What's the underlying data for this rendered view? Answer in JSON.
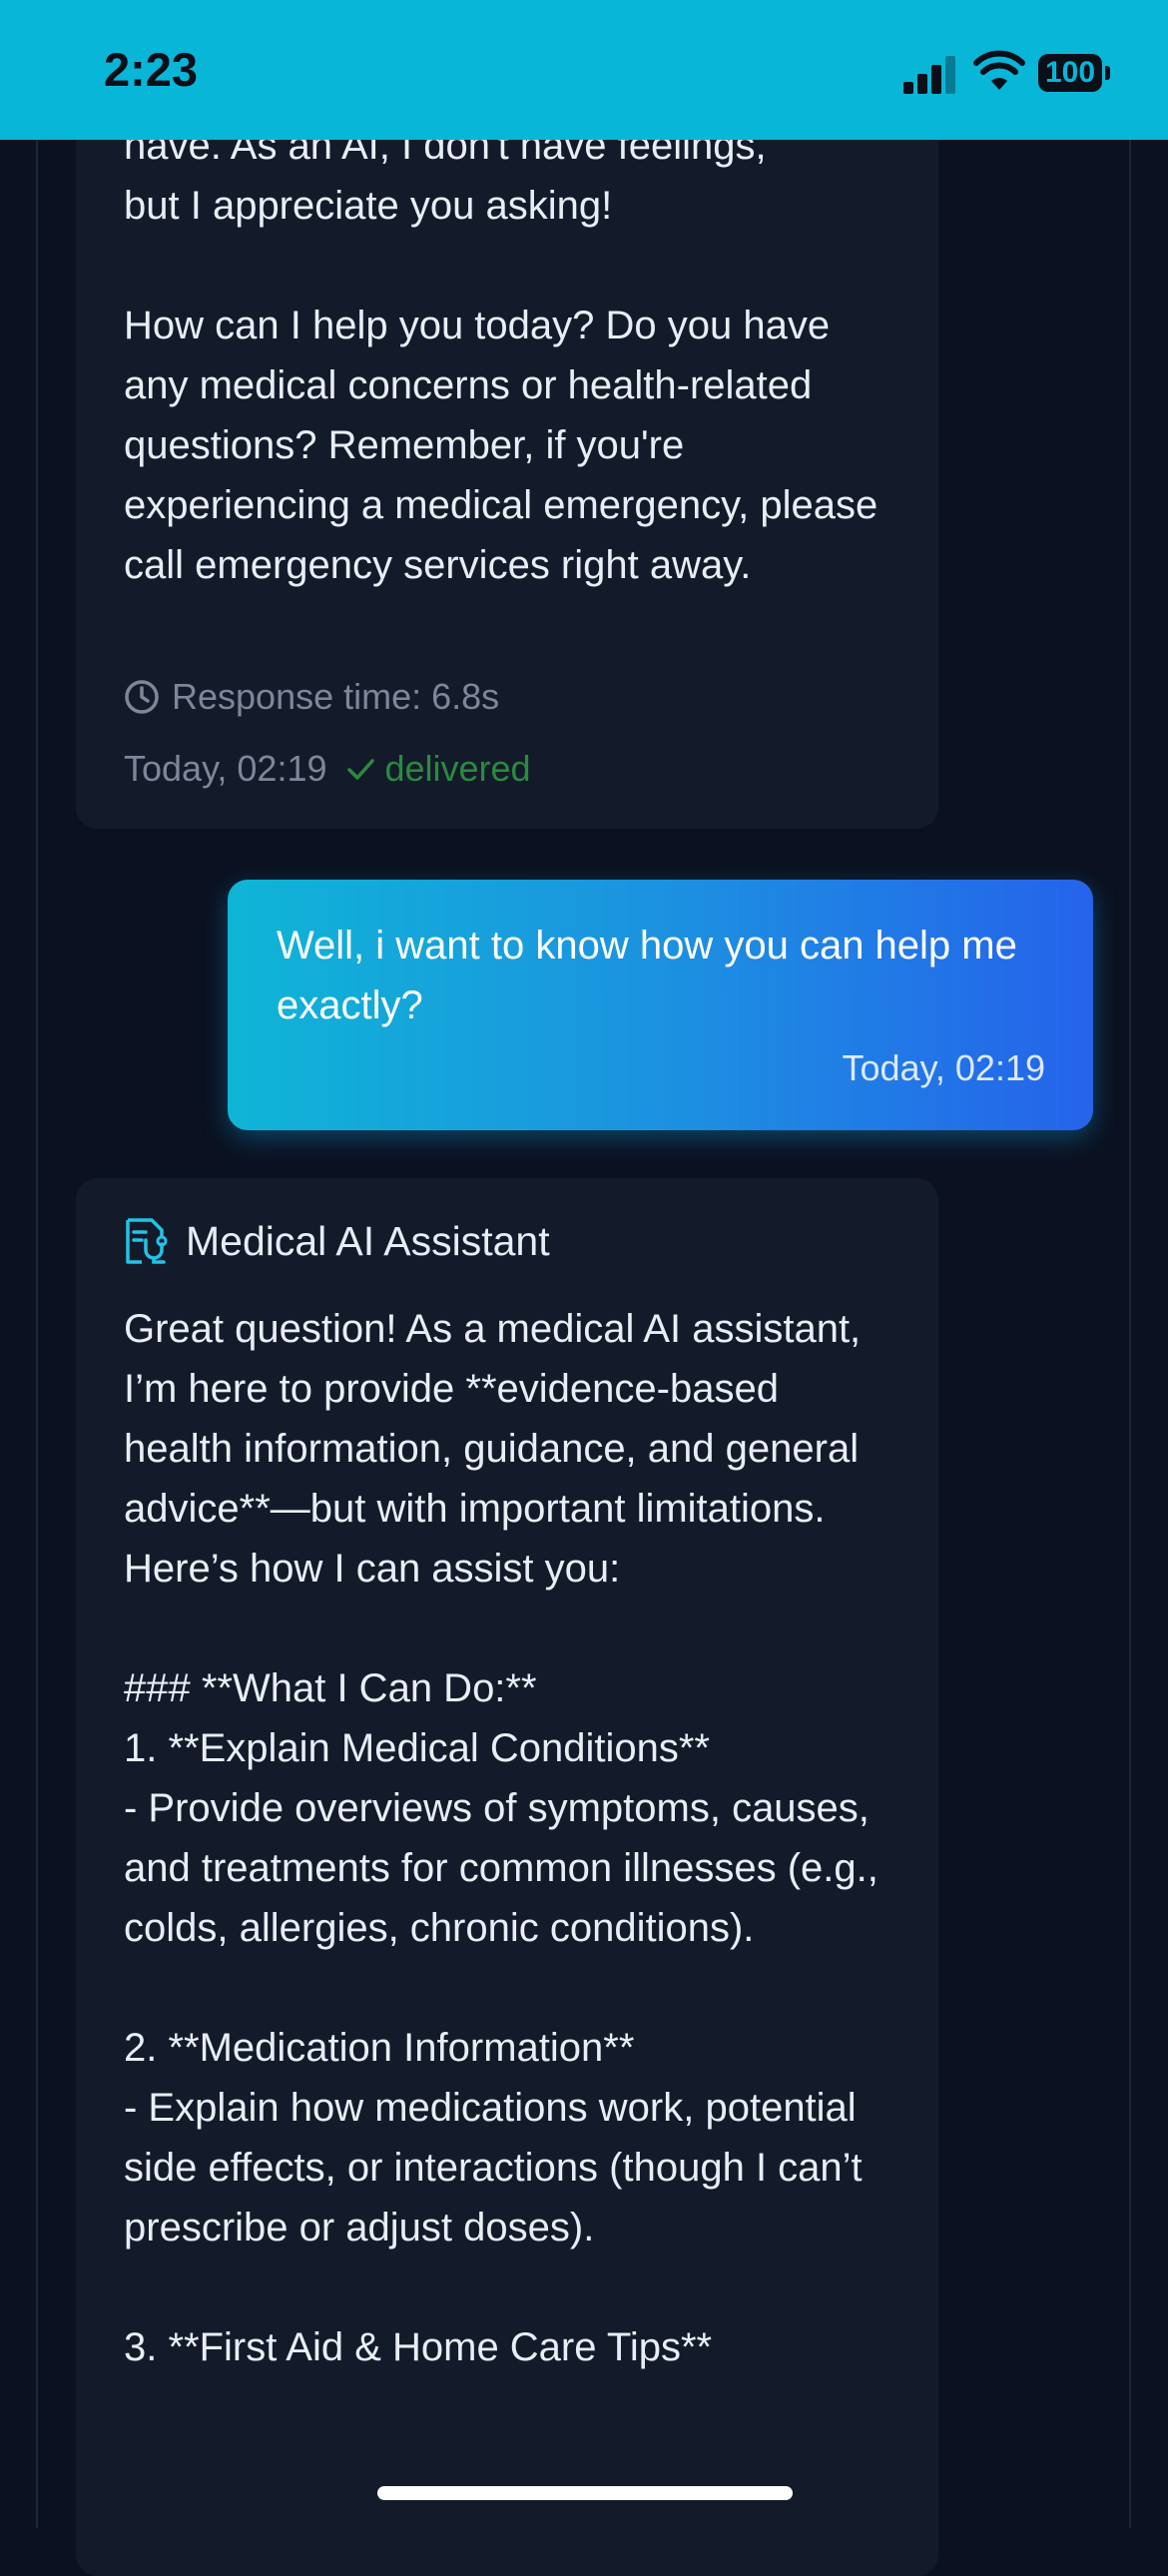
{
  "status_bar": {
    "time": "2:23",
    "battery": "100"
  },
  "messages": {
    "first_ai": {
      "text_top": "have. As an AI, I don't have feelings,\nbut I appreciate you asking!\n\nHow can I help you today? Do you have any medical concerns or health-related questions? Remember, if you're experiencing a medical emergency, please call emergency services right away.",
      "response_time": "Response time: 6.8s",
      "timestamp": "Today, 02:19",
      "status": "delivered"
    },
    "user": {
      "text": "Well, i want to know how you can help me exactly?",
      "timestamp": "Today, 02:19"
    },
    "second_ai": {
      "sender": "Medical AI Assistant",
      "text": "Great question! As a medical AI assistant, I’m here to provide **evidence-based health information, guidance, and general advice**—but with important limitations. Here’s how I can assist you:\n\n### **What I Can Do:**\n1. **Explain Medical Conditions**\n- Provide overviews of symptoms, causes, and treatments for common illnesses (e.g., colds, allergies, chronic conditions).\n\n2. **Medication Information**\n- Explain how medications work, potential side effects, or interactions (though I can’t prescribe or adjust doses).\n\n3. **First Aid & Home Care Tips**"
    }
  },
  "icons": {
    "clock": "clock-icon",
    "check": "check-icon",
    "assistant": "medical-assistant-icon"
  },
  "colors": {
    "status_bar": "#08b6d8",
    "background": "#0b1120",
    "ai_bubble": "#131b2b",
    "user_gradient_start": "#0fb5d6",
    "user_gradient_end": "#2563eb",
    "delivered": "#2b8a3e",
    "assistant_icon": "#22c3e6"
  }
}
